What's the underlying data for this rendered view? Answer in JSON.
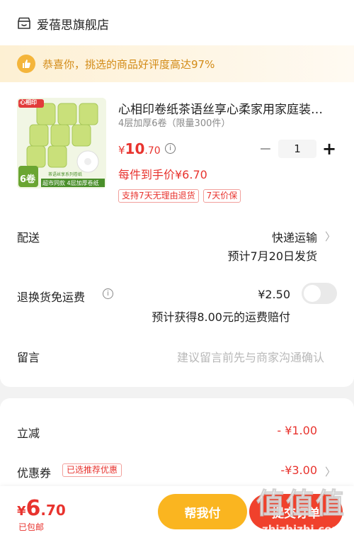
{
  "shop": {
    "name": "爱蓓思旗舰店",
    "icon": "store-icon"
  },
  "praise": {
    "text": "恭喜你，挑选的商品好评度高达97%",
    "icon": "thumbs-up-icon"
  },
  "product": {
    "title": "心相印卷纸茶语丝享心柔家用家庭装…",
    "spec": "4层加厚6卷（限量300件）",
    "price_symbol": "¥",
    "price_int": "10",
    "price_dec": ".70",
    "unit_price": "每件到手价¥6.70",
    "quantity": "1",
    "minus": "−",
    "plus": "+",
    "tags": [
      "支持7天无理由退货",
      "7天价保"
    ],
    "image": {
      "brand": "心相印",
      "roll_count": "6卷",
      "series": "茶语丝享系列卷纸",
      "banner": "超市同款 4层加厚卷纸"
    }
  },
  "delivery": {
    "label": "配送",
    "method": "快递运输",
    "eta": "预计7月20日发货"
  },
  "return_insurance": {
    "label": "退换货免运费",
    "price": "¥2.50",
    "note": "预计获得8.00元的运费赔付",
    "enabled": false
  },
  "message": {
    "label": "留言",
    "placeholder": "建议留言前先与商家沟通确认"
  },
  "discounts": {
    "instant": {
      "label": "立减",
      "amount": "- ¥1.00"
    },
    "coupon": {
      "label": "优惠券",
      "tag": "已选推荐优惠",
      "amount": "-¥3.00"
    }
  },
  "footer": {
    "total_symbol": "¥",
    "total_int": "6",
    "total_dec": ".70",
    "shipping": "已包邮",
    "help_button": "帮我付",
    "pay_button": "提交订单",
    "watermark": "值值值",
    "watermark_url": "zhizhizhi.com"
  },
  "colors": {
    "accent": "#e8332e",
    "gold": "#fab520",
    "praise": "#d38b17"
  }
}
